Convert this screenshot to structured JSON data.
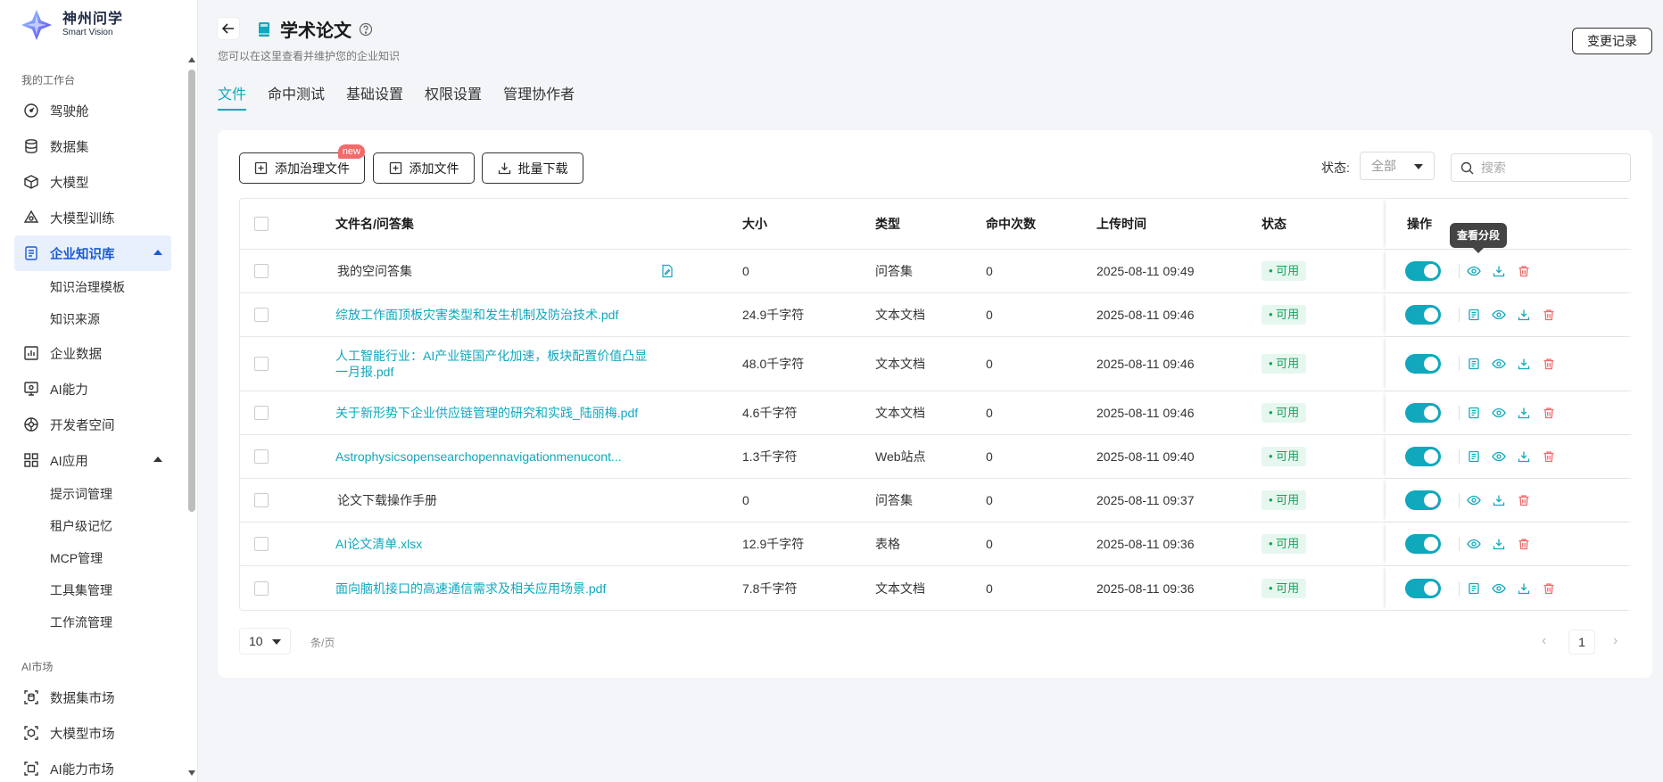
{
  "brand": {
    "name_cn": "神州问学",
    "name_en": "Smart Vision"
  },
  "sidebar": {
    "group1": "我的工作台",
    "items": [
      {
        "label": "驾驶舱",
        "icon": "dashboard-icon"
      },
      {
        "label": "数据集",
        "icon": "database-icon"
      },
      {
        "label": "大模型",
        "icon": "cube-icon"
      },
      {
        "label": "大模型训练",
        "icon": "training-icon"
      },
      {
        "label": "企业知识库",
        "icon": "knowledge-icon",
        "active": true,
        "expanded": true,
        "children": [
          "知识治理模板",
          "知识来源"
        ]
      },
      {
        "label": "企业数据",
        "icon": "chart-icon"
      },
      {
        "label": "AI能力",
        "icon": "ai-capability-icon"
      },
      {
        "label": "开发者空间",
        "icon": "developer-icon"
      },
      {
        "label": "AI应用",
        "icon": "apps-icon",
        "expanded": true,
        "children": [
          "提示词管理",
          "租户级记忆",
          "MCP管理",
          "工具集管理",
          "工作流管理"
        ]
      }
    ],
    "group2": "AI市场",
    "market": [
      {
        "label": "数据集市场",
        "icon": "dataset-market-icon"
      },
      {
        "label": "大模型市场",
        "icon": "model-market-icon"
      },
      {
        "label": "AI能力市场",
        "icon": "ai-market-icon"
      }
    ]
  },
  "header": {
    "title": "学术论文",
    "subtitle": "您可以在这里查看并维护您的企业知识",
    "change_log": "变更记录",
    "tabs": [
      "文件",
      "命中测试",
      "基础设置",
      "权限设置",
      "管理协作者"
    ],
    "active_tab": 0
  },
  "toolbar": {
    "add_governance": "添加治理文件",
    "new_badge": "new",
    "add_file": "添加文件",
    "batch_download": "批量下载",
    "status_label": "状态:",
    "status_value": "全部",
    "search_placeholder": "搜索"
  },
  "table": {
    "columns": [
      "文件名/问答集",
      "大小",
      "类型",
      "命中次数",
      "上传时间",
      "状态",
      "操作"
    ],
    "rows": [
      {
        "name": "我的空问答集",
        "size": "0",
        "type": "问答集",
        "hits": "0",
        "time": "2025-08-11 09:49",
        "status": "可用",
        "link": false,
        "qa": true,
        "segments": false
      },
      {
        "name": "综放工作面顶板灾害类型和发生机制及防治技术.pdf",
        "size": "24.9千字符",
        "type": "文本文档",
        "hits": "0",
        "time": "2025-08-11 09:46",
        "status": "可用",
        "link": true,
        "qa": false,
        "segments": true
      },
      {
        "name": "人工智能行业：AI产业链国产化加速，板块配置价值凸显一月报.pdf",
        "size": "48.0千字符",
        "type": "文本文档",
        "hits": "0",
        "time": "2025-08-11 09:46",
        "status": "可用",
        "link": true,
        "qa": false,
        "segments": true
      },
      {
        "name": "关于新形势下企业供应链管理的研究和实践_陆丽梅.pdf",
        "size": "4.6千字符",
        "type": "文本文档",
        "hits": "0",
        "time": "2025-08-11 09:46",
        "status": "可用",
        "link": true,
        "qa": false,
        "segments": true
      },
      {
        "name": "Astrophysicsopensearchopennavigationmenucont...",
        "size": "1.3千字符",
        "type": "Web站点",
        "hits": "0",
        "time": "2025-08-11 09:40",
        "status": "可用",
        "link": true,
        "qa": false,
        "segments": true
      },
      {
        "name": "论文下载操作手册",
        "size": "0",
        "type": "问答集",
        "hits": "0",
        "time": "2025-08-11 09:37",
        "status": "可用",
        "link": false,
        "qa": false,
        "segments": false
      },
      {
        "name": "AI论文清单.xlsx",
        "size": "12.9千字符",
        "type": "表格",
        "hits": "0",
        "time": "2025-08-11 09:36",
        "status": "可用",
        "link": true,
        "qa": false,
        "segments": false
      },
      {
        "name": "面向脑机接口的高速通信需求及相关应用场景.pdf",
        "size": "7.8千字符",
        "type": "文本文档",
        "hits": "0",
        "time": "2025-08-11 09:36",
        "status": "可用",
        "link": true,
        "qa": false,
        "segments": true
      }
    ]
  },
  "tooltip": "查看分段",
  "pagination": {
    "page_size": "10",
    "unit": "条/页",
    "current": "1"
  },
  "colors": {
    "accent": "#10a8bd",
    "active_nav": "#1a5ad8",
    "danger": "#f26a6a",
    "success": "#15a35a"
  }
}
